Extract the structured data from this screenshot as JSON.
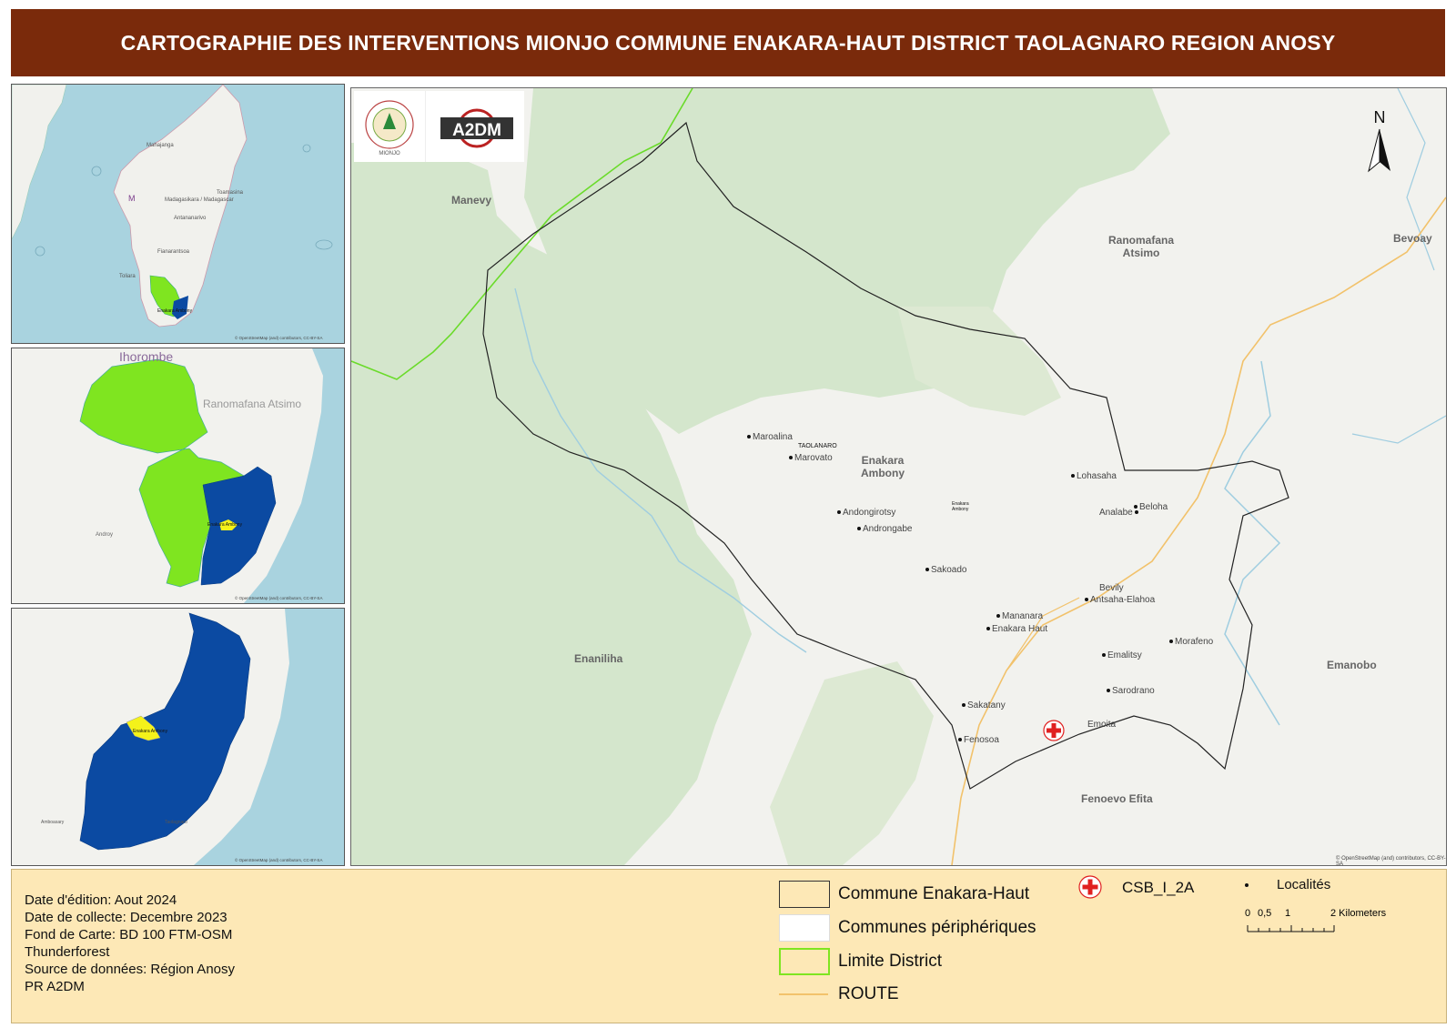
{
  "title": "CARTOGRAPHIE DES INTERVENTIONS MIONJO COMMUNE ENAKARA-HAUT DISTRICT TAOLAGNARO REGION ANOSY",
  "colors": {
    "title_bg": "#7a2a0b",
    "forest": "#d4e6cc",
    "water": "#a9d3df",
    "region_green": "#7fe520",
    "district_blue": "#0b4aa2",
    "commune_yellow": "#f4f21a",
    "legend_bg": "#fde8b6",
    "route": "#f2c26b",
    "csb_red": "#e02020"
  },
  "inset1": {
    "labels": [
      "Mahajanga",
      "Madagasikara / Madagascar",
      "M",
      "Toamasina",
      "Antananarivo",
      "Fianarantsoa",
      "Toliara",
      "Enakara Ambony"
    ],
    "attribution": "© OpenStreetMap (and) contributors, CC-BY-SA"
  },
  "inset2": {
    "labels": [
      "Ihorombe",
      "Ranomafana Atsimo",
      "Androy",
      "Enakara Ambony"
    ],
    "attribution": "© OpenStreetMap (and) contributors, CC-BY-SA"
  },
  "inset3": {
    "labels": [
      "Enakara Ambony",
      "Amboasary",
      "Taolagnaro"
    ],
    "attribution": "© OpenStreetMap (and) contributors, CC-BY-SA"
  },
  "main_map": {
    "north": "N",
    "logo1_text": "MIONJO",
    "logo2_text": "A2DM",
    "place_labels": {
      "manevy": "Manevy",
      "ranomafana": "Ranomafana\nAtsimo",
      "bevoay": "Bevoay",
      "enakara_ambony": "Enakara\nAmbony",
      "enaniliha": "Enaniliha",
      "emanobo": "Emanobo",
      "fenoevo_efita": "Fenoevo Efita",
      "taolanaro": "TAOLANARO",
      "enakara_small": "Enakara\nAmbony"
    },
    "localities": [
      "Maroalina",
      "Marovato",
      "Andongirotsy",
      "Androngabe",
      "Sakoado",
      "Lohasaha",
      "Analabe",
      "Beloha",
      "Bevily",
      "Antsaha-Elahoa",
      "Mananara",
      "Enakara Haut",
      "Emalitsy",
      "Morafeno",
      "Sarodrano",
      "Sakatany",
      "Fenosoa",
      "Emoita"
    ],
    "attribution": "© OpenStreetMap (and) contributors, CC-BY-SA"
  },
  "legend": {
    "meta": [
      "Date d'édition: Aout 2024",
      "Date de collecte: Decembre 2023",
      "Fond de Carte: BD 100 FTM-OSM",
      "Thunderforest",
      "Source de données: Région Anosy",
      "PR A2DM"
    ],
    "items": [
      "Commune Enakara-Haut",
      "Communes périphériques",
      "Limite District",
      "ROUTE"
    ],
    "csb": "CSB_I_2A",
    "localites": "Localités",
    "scale_ticks": [
      "0",
      "0,5",
      "1",
      "2 Kilometers"
    ]
  }
}
